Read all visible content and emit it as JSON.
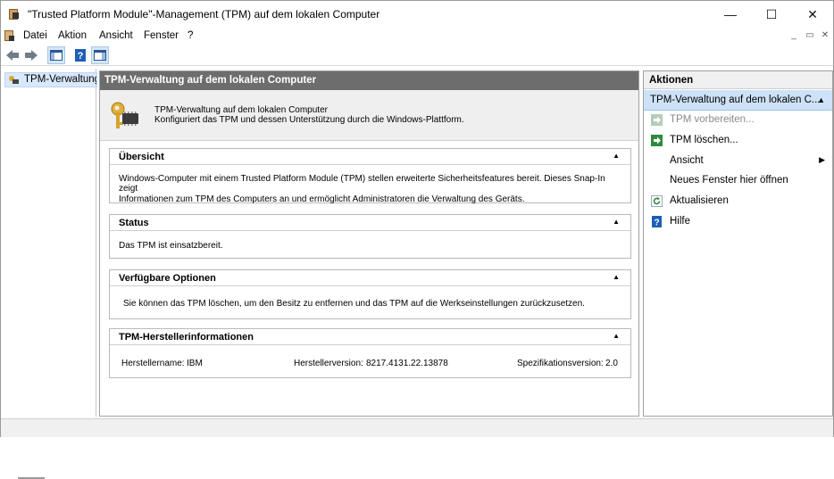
{
  "window": {
    "title": "\"Trusted Platform Module\"-Management (TPM) auf dem lokalen Computer",
    "controls": {
      "minimize": "—",
      "maximize": "☐",
      "close": "✕"
    }
  },
  "menubar": {
    "items": [
      {
        "label": "Datei"
      },
      {
        "label": "Aktion"
      },
      {
        "label": "Ansicht"
      },
      {
        "label": "Fenster"
      },
      {
        "label": "?"
      }
    ],
    "child_controls": {
      "minimize": "_",
      "restore": "▭",
      "close": "✕"
    }
  },
  "toolbar": {
    "buttons": [
      "back-arrow-icon",
      "forward-arrow-icon",
      "show-hide-tree-icon",
      "help-icon",
      "show-hide-action-pane-icon"
    ]
  },
  "tree": {
    "selected_item": "TPM-Verwaltung"
  },
  "center": {
    "header": "TPM-Verwaltung auf dem lokalen Computer",
    "intro": {
      "line1": "TPM-Verwaltung auf dem lokalen Computer",
      "line2": "Konfiguriert das TPM und dessen Unterstützung durch die Windows-Plattform."
    },
    "sections": {
      "overview": {
        "title": "Übersicht",
        "text1": "Windows-Computer mit einem Trusted Platform Module (TPM) stellen erweiterte Sicherheitsfeatures bereit. Dieses Snap-In zeigt",
        "text2": "Informationen zum TPM des Computers an und ermöglicht Administratoren die Verwaltung des Geräts."
      },
      "status": {
        "title": "Status",
        "text": "Das TPM ist einsatzbereit."
      },
      "options": {
        "title": "Verfügbare Optionen",
        "text": "Sie können das TPM löschen, um den Besitz zu entfernen und das TPM auf die Werkseinstellungen zurückzusetzen."
      },
      "manufacturer": {
        "title": "TPM-Herstellerinformationen",
        "name_label": "Herstellername:",
        "name_value": "IBM",
        "version_label": "Herstellerversion:",
        "version_value": "8217.4131.22.13878",
        "spec_label": "Spezifikationsversion:",
        "spec_value": "2.0"
      }
    }
  },
  "actions": {
    "header": "Aktionen",
    "group": "TPM-Verwaltung auf dem lokalen C...",
    "items": [
      {
        "label": "TPM vorbereiten...",
        "enabled": false,
        "icon": "green-arrow-icon"
      },
      {
        "label": "TPM löschen...",
        "enabled": true,
        "icon": "green-arrow-icon"
      },
      {
        "label": "Ansicht",
        "enabled": true,
        "icon": "",
        "submenu": true
      },
      {
        "label": "Neues Fenster hier öffnen",
        "enabled": true,
        "icon": ""
      },
      {
        "label": "Aktualisieren",
        "enabled": true,
        "icon": "refresh-icon"
      },
      {
        "label": "Hilfe",
        "enabled": true,
        "icon": "help-icon"
      }
    ]
  },
  "colors": {
    "center_header_bg": "#6d6d6d",
    "actions_group_bg": "#cde2f7",
    "tree_selected_bg": "#d9e8fa",
    "action_green": "#2e8b3d",
    "help_blue": "#1e5fb5"
  }
}
